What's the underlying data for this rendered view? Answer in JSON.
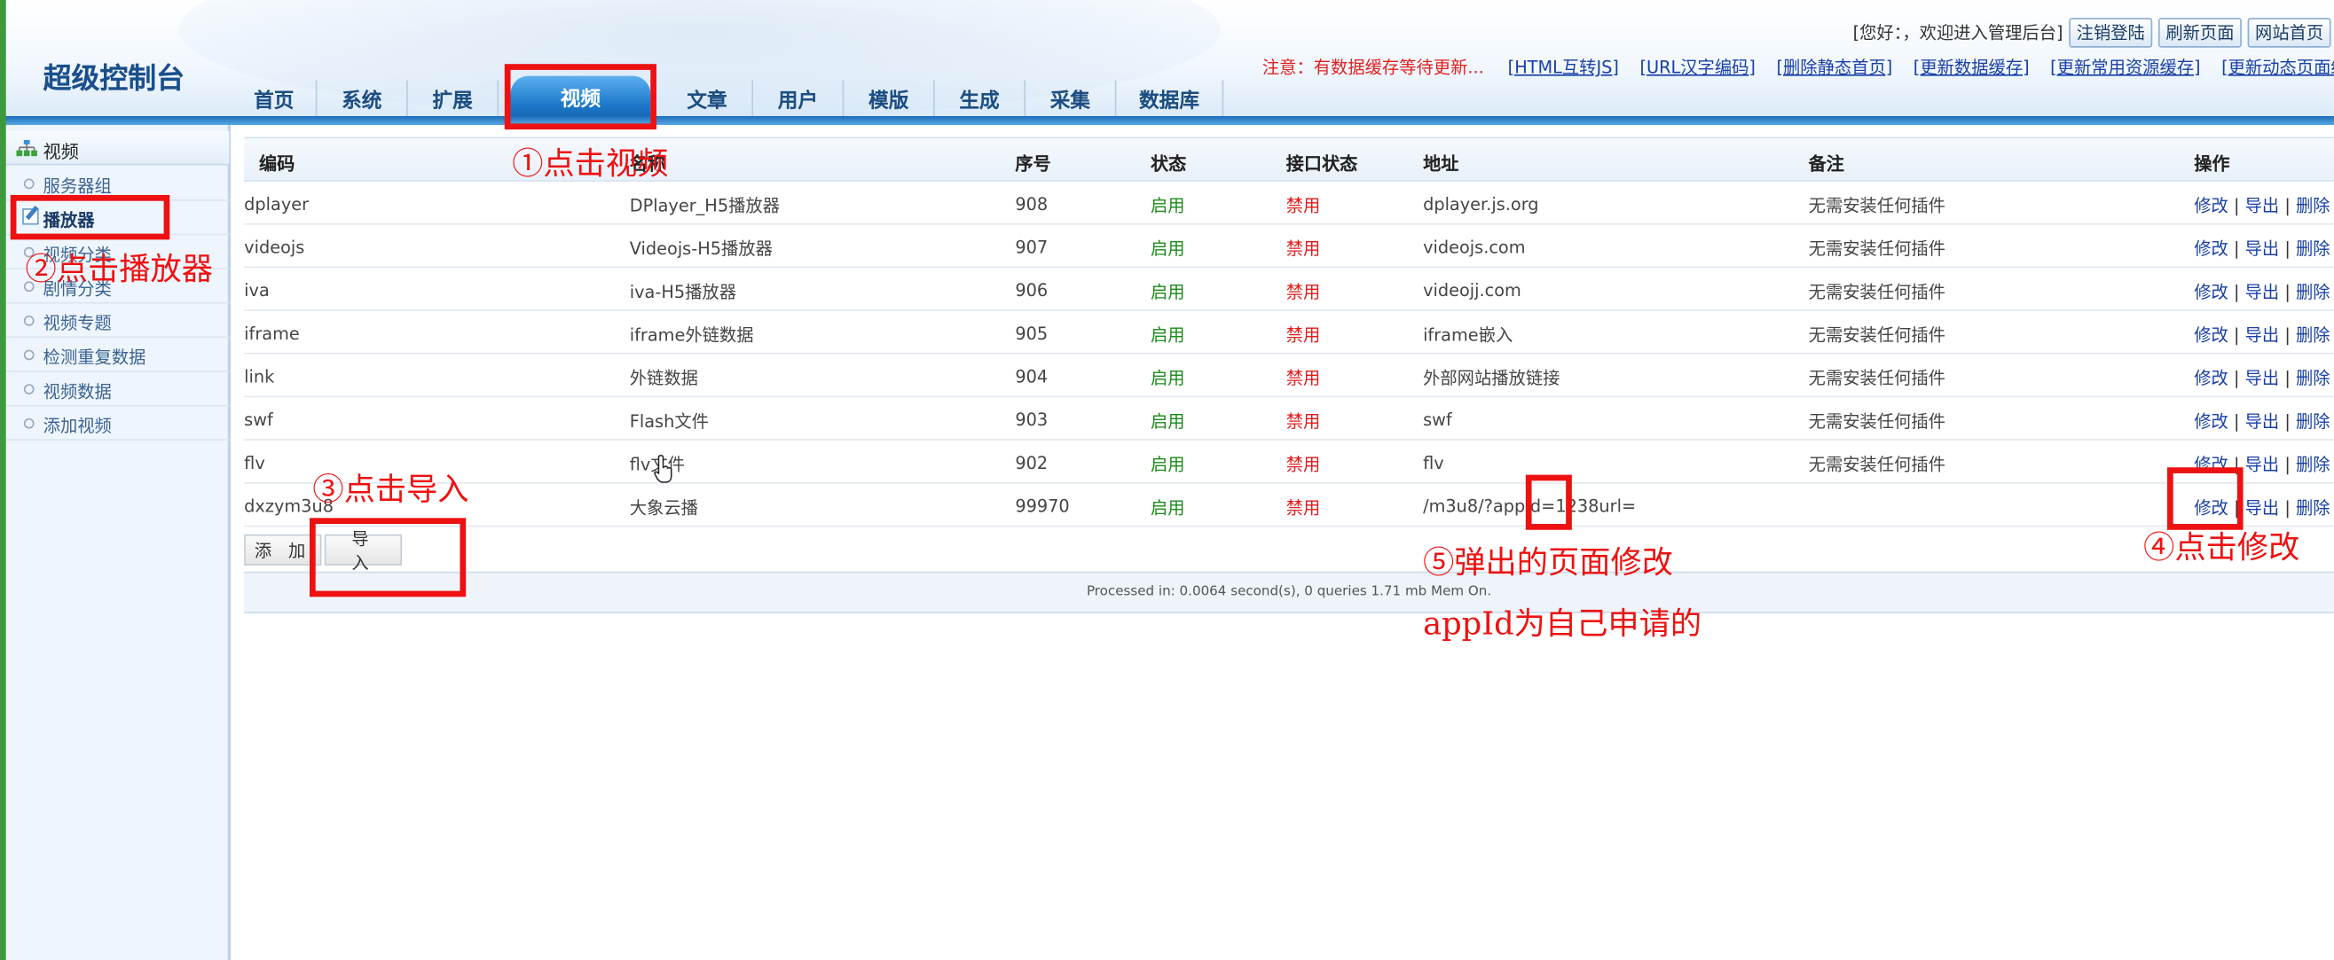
{
  "header": {
    "logo": "超级控制台",
    "greeting": "[您好：，欢迎进入管理后台]",
    "buttons": [
      "注销登陆",
      "刷新页面",
      "网站首页"
    ],
    "warning": "注意：有数据缓存等待更新...",
    "links": [
      "[HTML互转JS]",
      "[URL汉字编码]",
      "[删除静态首页]",
      "[更新数据缓存]",
      "[更新常用资源缓存]",
      "[更新动态页面缓存"
    ]
  },
  "nav": [
    {
      "label": "首页"
    },
    {
      "label": "系统"
    },
    {
      "label": "扩展"
    },
    {
      "label": "视频",
      "active": true
    },
    {
      "label": "文章"
    },
    {
      "label": "用户"
    },
    {
      "label": "模版"
    },
    {
      "label": "生成"
    },
    {
      "label": "采集"
    },
    {
      "label": "数据库"
    }
  ],
  "sidebar": {
    "title": "视频",
    "items": [
      {
        "label": "服务器组"
      },
      {
        "label": "播放器",
        "active": true
      },
      {
        "label": "视频分类"
      },
      {
        "label": "剧情分类"
      },
      {
        "label": "视频专题"
      },
      {
        "label": "检测重复数据"
      },
      {
        "label": "视频数据"
      },
      {
        "label": "添加视频"
      }
    ]
  },
  "table": {
    "headers": [
      "编码",
      "名称",
      "序号",
      "状态",
      "接口状态",
      "地址",
      "备注",
      "操作"
    ],
    "rows": [
      {
        "code": "dplayer",
        "name": "DPlayer_H5播放器",
        "seq": "908",
        "status": "启用",
        "api": "禁用",
        "addr": "dplayer.js.org",
        "note": "无需安装任何插件"
      },
      {
        "code": "videojs",
        "name": "Videojs-H5播放器",
        "seq": "907",
        "status": "启用",
        "api": "禁用",
        "addr": "videojs.com",
        "note": "无需安装任何插件"
      },
      {
        "code": "iva",
        "name": "iva-H5播放器",
        "seq": "906",
        "status": "启用",
        "api": "禁用",
        "addr": "videojj.com",
        "note": "无需安装任何插件"
      },
      {
        "code": "iframe",
        "name": "iframe外链数据",
        "seq": "905",
        "status": "启用",
        "api": "禁用",
        "addr": "iframe嵌入",
        "note": "无需安装任何插件"
      },
      {
        "code": "link",
        "name": "外链数据",
        "seq": "904",
        "status": "启用",
        "api": "禁用",
        "addr": "外部网站播放链接",
        "note": "无需安装任何插件"
      },
      {
        "code": "swf",
        "name": "Flash文件",
        "seq": "903",
        "status": "启用",
        "api": "禁用",
        "addr": "swf",
        "note": "无需安装任何插件"
      },
      {
        "code": "flv",
        "name": "flv文件",
        "seq": "902",
        "status": "启用",
        "api": "禁用",
        "addr": "flv",
        "note": "无需安装任何插件"
      },
      {
        "code": "dxzym3u8",
        "name": "大象云播",
        "seq": "99970",
        "status": "启用",
        "api": "禁用",
        "addr": "/m3u8/?appId=1238url=",
        "note": ""
      }
    ],
    "ops": {
      "edit": "修改",
      "export": "导出",
      "delete": "删除",
      "sep": " | "
    },
    "add_label": "添 加",
    "import_label": "导 入",
    "footer": "Processed in: 0.0064 second(s), 0 queries 1.71 mb Mem On."
  },
  "annotations": {
    "step1": "①点击视频",
    "step2": "②点击播放器",
    "step3": "③点击导入",
    "step4": "④点击修改",
    "step5a": "⑤弹出的页面修改",
    "step5b": "appId为自己申请的"
  }
}
